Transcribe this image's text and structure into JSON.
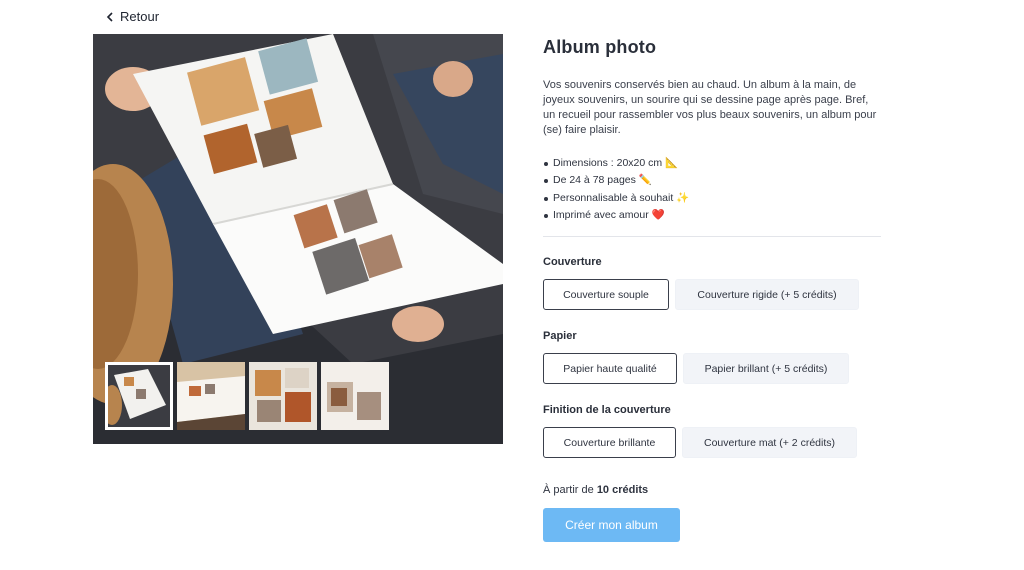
{
  "nav": {
    "back_label": "Retour"
  },
  "product": {
    "title": "Album photo",
    "description": "Vos souvenirs conservés bien au chaud. Un album à la main, de joyeux souvenirs, un sourire qui se dessine page après page. Bref, un recueil pour rassembler vos plus beaux souvenirs, un album pour (se) faire plaisir.",
    "features": [
      "Dimensions : 20x20 cm 📐",
      "De 24 à 78 pages ✏️",
      "Personnalisable à souhait ✨",
      " Imprimé avec amour ❤️"
    ]
  },
  "options": [
    {
      "label": "Couverture",
      "choices": [
        "Couverture souple",
        "Couverture rigide (+ 5 crédits)"
      ],
      "selected": 0
    },
    {
      "label": "Papier",
      "choices": [
        "Papier haute qualité",
        "Papier brillant (+ 5 crédits)"
      ],
      "selected": 0
    },
    {
      "label": "Finition de la couverture",
      "choices": [
        "Couverture brillante",
        "Couverture mat (+ 2 crédits)"
      ],
      "selected": 0
    }
  ],
  "pricing": {
    "prefix": "À partir de",
    "amount": "10 crédits"
  },
  "cta": {
    "label": "Créer mon album",
    "color": "#6db9f4"
  },
  "gallery": {
    "thumbnail_count": 4,
    "active_index": 0
  }
}
